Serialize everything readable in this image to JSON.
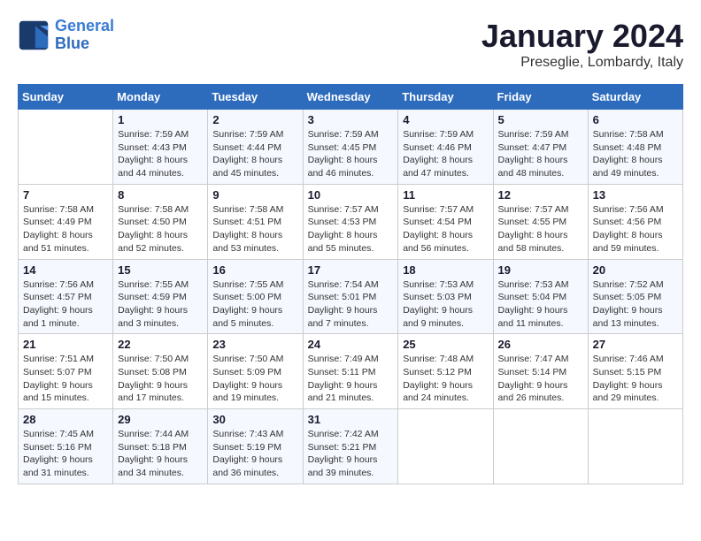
{
  "logo": {
    "line1": "General",
    "line2": "Blue"
  },
  "title": "January 2024",
  "subtitle": "Preseglie, Lombardy, Italy",
  "days_of_week": [
    "Sunday",
    "Monday",
    "Tuesday",
    "Wednesday",
    "Thursday",
    "Friday",
    "Saturday"
  ],
  "weeks": [
    [
      {
        "day": "",
        "sunrise": "",
        "sunset": "",
        "daylight": ""
      },
      {
        "day": "1",
        "sunrise": "Sunrise: 7:59 AM",
        "sunset": "Sunset: 4:43 PM",
        "daylight": "Daylight: 8 hours and 44 minutes."
      },
      {
        "day": "2",
        "sunrise": "Sunrise: 7:59 AM",
        "sunset": "Sunset: 4:44 PM",
        "daylight": "Daylight: 8 hours and 45 minutes."
      },
      {
        "day": "3",
        "sunrise": "Sunrise: 7:59 AM",
        "sunset": "Sunset: 4:45 PM",
        "daylight": "Daylight: 8 hours and 46 minutes."
      },
      {
        "day": "4",
        "sunrise": "Sunrise: 7:59 AM",
        "sunset": "Sunset: 4:46 PM",
        "daylight": "Daylight: 8 hours and 47 minutes."
      },
      {
        "day": "5",
        "sunrise": "Sunrise: 7:59 AM",
        "sunset": "Sunset: 4:47 PM",
        "daylight": "Daylight: 8 hours and 48 minutes."
      },
      {
        "day": "6",
        "sunrise": "Sunrise: 7:58 AM",
        "sunset": "Sunset: 4:48 PM",
        "daylight": "Daylight: 8 hours and 49 minutes."
      }
    ],
    [
      {
        "day": "7",
        "sunrise": "Sunrise: 7:58 AM",
        "sunset": "Sunset: 4:49 PM",
        "daylight": "Daylight: 8 hours and 51 minutes."
      },
      {
        "day": "8",
        "sunrise": "Sunrise: 7:58 AM",
        "sunset": "Sunset: 4:50 PM",
        "daylight": "Daylight: 8 hours and 52 minutes."
      },
      {
        "day": "9",
        "sunrise": "Sunrise: 7:58 AM",
        "sunset": "Sunset: 4:51 PM",
        "daylight": "Daylight: 8 hours and 53 minutes."
      },
      {
        "day": "10",
        "sunrise": "Sunrise: 7:57 AM",
        "sunset": "Sunset: 4:53 PM",
        "daylight": "Daylight: 8 hours and 55 minutes."
      },
      {
        "day": "11",
        "sunrise": "Sunrise: 7:57 AM",
        "sunset": "Sunset: 4:54 PM",
        "daylight": "Daylight: 8 hours and 56 minutes."
      },
      {
        "day": "12",
        "sunrise": "Sunrise: 7:57 AM",
        "sunset": "Sunset: 4:55 PM",
        "daylight": "Daylight: 8 hours and 58 minutes."
      },
      {
        "day": "13",
        "sunrise": "Sunrise: 7:56 AM",
        "sunset": "Sunset: 4:56 PM",
        "daylight": "Daylight: 8 hours and 59 minutes."
      }
    ],
    [
      {
        "day": "14",
        "sunrise": "Sunrise: 7:56 AM",
        "sunset": "Sunset: 4:57 PM",
        "daylight": "Daylight: 9 hours and 1 minute."
      },
      {
        "day": "15",
        "sunrise": "Sunrise: 7:55 AM",
        "sunset": "Sunset: 4:59 PM",
        "daylight": "Daylight: 9 hours and 3 minutes."
      },
      {
        "day": "16",
        "sunrise": "Sunrise: 7:55 AM",
        "sunset": "Sunset: 5:00 PM",
        "daylight": "Daylight: 9 hours and 5 minutes."
      },
      {
        "day": "17",
        "sunrise": "Sunrise: 7:54 AM",
        "sunset": "Sunset: 5:01 PM",
        "daylight": "Daylight: 9 hours and 7 minutes."
      },
      {
        "day": "18",
        "sunrise": "Sunrise: 7:53 AM",
        "sunset": "Sunset: 5:03 PM",
        "daylight": "Daylight: 9 hours and 9 minutes."
      },
      {
        "day": "19",
        "sunrise": "Sunrise: 7:53 AM",
        "sunset": "Sunset: 5:04 PM",
        "daylight": "Daylight: 9 hours and 11 minutes."
      },
      {
        "day": "20",
        "sunrise": "Sunrise: 7:52 AM",
        "sunset": "Sunset: 5:05 PM",
        "daylight": "Daylight: 9 hours and 13 minutes."
      }
    ],
    [
      {
        "day": "21",
        "sunrise": "Sunrise: 7:51 AM",
        "sunset": "Sunset: 5:07 PM",
        "daylight": "Daylight: 9 hours and 15 minutes."
      },
      {
        "day": "22",
        "sunrise": "Sunrise: 7:50 AM",
        "sunset": "Sunset: 5:08 PM",
        "daylight": "Daylight: 9 hours and 17 minutes."
      },
      {
        "day": "23",
        "sunrise": "Sunrise: 7:50 AM",
        "sunset": "Sunset: 5:09 PM",
        "daylight": "Daylight: 9 hours and 19 minutes."
      },
      {
        "day": "24",
        "sunrise": "Sunrise: 7:49 AM",
        "sunset": "Sunset: 5:11 PM",
        "daylight": "Daylight: 9 hours and 21 minutes."
      },
      {
        "day": "25",
        "sunrise": "Sunrise: 7:48 AM",
        "sunset": "Sunset: 5:12 PM",
        "daylight": "Daylight: 9 hours and 24 minutes."
      },
      {
        "day": "26",
        "sunrise": "Sunrise: 7:47 AM",
        "sunset": "Sunset: 5:14 PM",
        "daylight": "Daylight: 9 hours and 26 minutes."
      },
      {
        "day": "27",
        "sunrise": "Sunrise: 7:46 AM",
        "sunset": "Sunset: 5:15 PM",
        "daylight": "Daylight: 9 hours and 29 minutes."
      }
    ],
    [
      {
        "day": "28",
        "sunrise": "Sunrise: 7:45 AM",
        "sunset": "Sunset: 5:16 PM",
        "daylight": "Daylight: 9 hours and 31 minutes."
      },
      {
        "day": "29",
        "sunrise": "Sunrise: 7:44 AM",
        "sunset": "Sunset: 5:18 PM",
        "daylight": "Daylight: 9 hours and 34 minutes."
      },
      {
        "day": "30",
        "sunrise": "Sunrise: 7:43 AM",
        "sunset": "Sunset: 5:19 PM",
        "daylight": "Daylight: 9 hours and 36 minutes."
      },
      {
        "day": "31",
        "sunrise": "Sunrise: 7:42 AM",
        "sunset": "Sunset: 5:21 PM",
        "daylight": "Daylight: 9 hours and 39 minutes."
      },
      {
        "day": "",
        "sunrise": "",
        "sunset": "",
        "daylight": ""
      },
      {
        "day": "",
        "sunrise": "",
        "sunset": "",
        "daylight": ""
      },
      {
        "day": "",
        "sunrise": "",
        "sunset": "",
        "daylight": ""
      }
    ]
  ]
}
